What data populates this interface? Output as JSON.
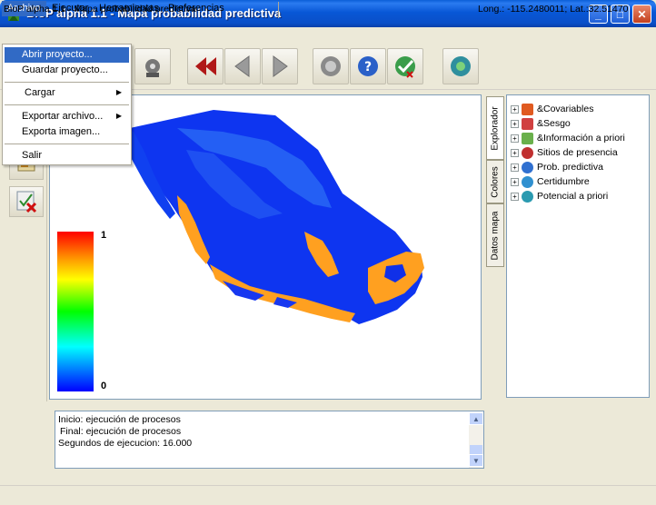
{
  "window": {
    "title": "BioP alpha 1.1 - Mapa probabilidad predictiva"
  },
  "menubar": [
    "Archivo",
    "Ejecutar",
    "Herramientas",
    "Preferencias"
  ],
  "archivo_menu": {
    "items": [
      "Abrir proyecto...",
      "Guardar proyecto...",
      "Cargar",
      "Exportar archivo...",
      "Exporta imagen...",
      "Salir"
    ]
  },
  "legend": {
    "max": "1",
    "min": "0"
  },
  "side_tabs": [
    "Explorador",
    "Colores",
    "Datos mapa"
  ],
  "tree": {
    "items": [
      "&Covariables",
      "&Sesgo",
      "&Información a priori",
      "Sitios de presencia",
      "Prob. predictiva",
      "Certidumbre",
      "Potencial a priori"
    ]
  },
  "log": {
    "lines": [
      "Inicio: ejecución de procesos",
      "Final: ejecución de procesos",
      "Segundos de ejecucion: 16.000"
    ]
  },
  "status": {
    "left": "BioP alpha 1.1 - Mapa probabilidad predictiva",
    "right": "Long.: -115.2480011; Lat.:32.51470"
  },
  "colors": {
    "accent": "#316AC5",
    "titlebar": "#0A5FD8",
    "map_blue": "#0000FF",
    "map_orange": "#FFA020"
  },
  "icons": [
    "gear-icon",
    "arrow-rewind-icon",
    "arrow-back-icon",
    "arrow-forward-icon",
    "globe-gear-icon",
    "globe-help-icon",
    "globe-check-icon",
    "globe-refresh-icon"
  ]
}
